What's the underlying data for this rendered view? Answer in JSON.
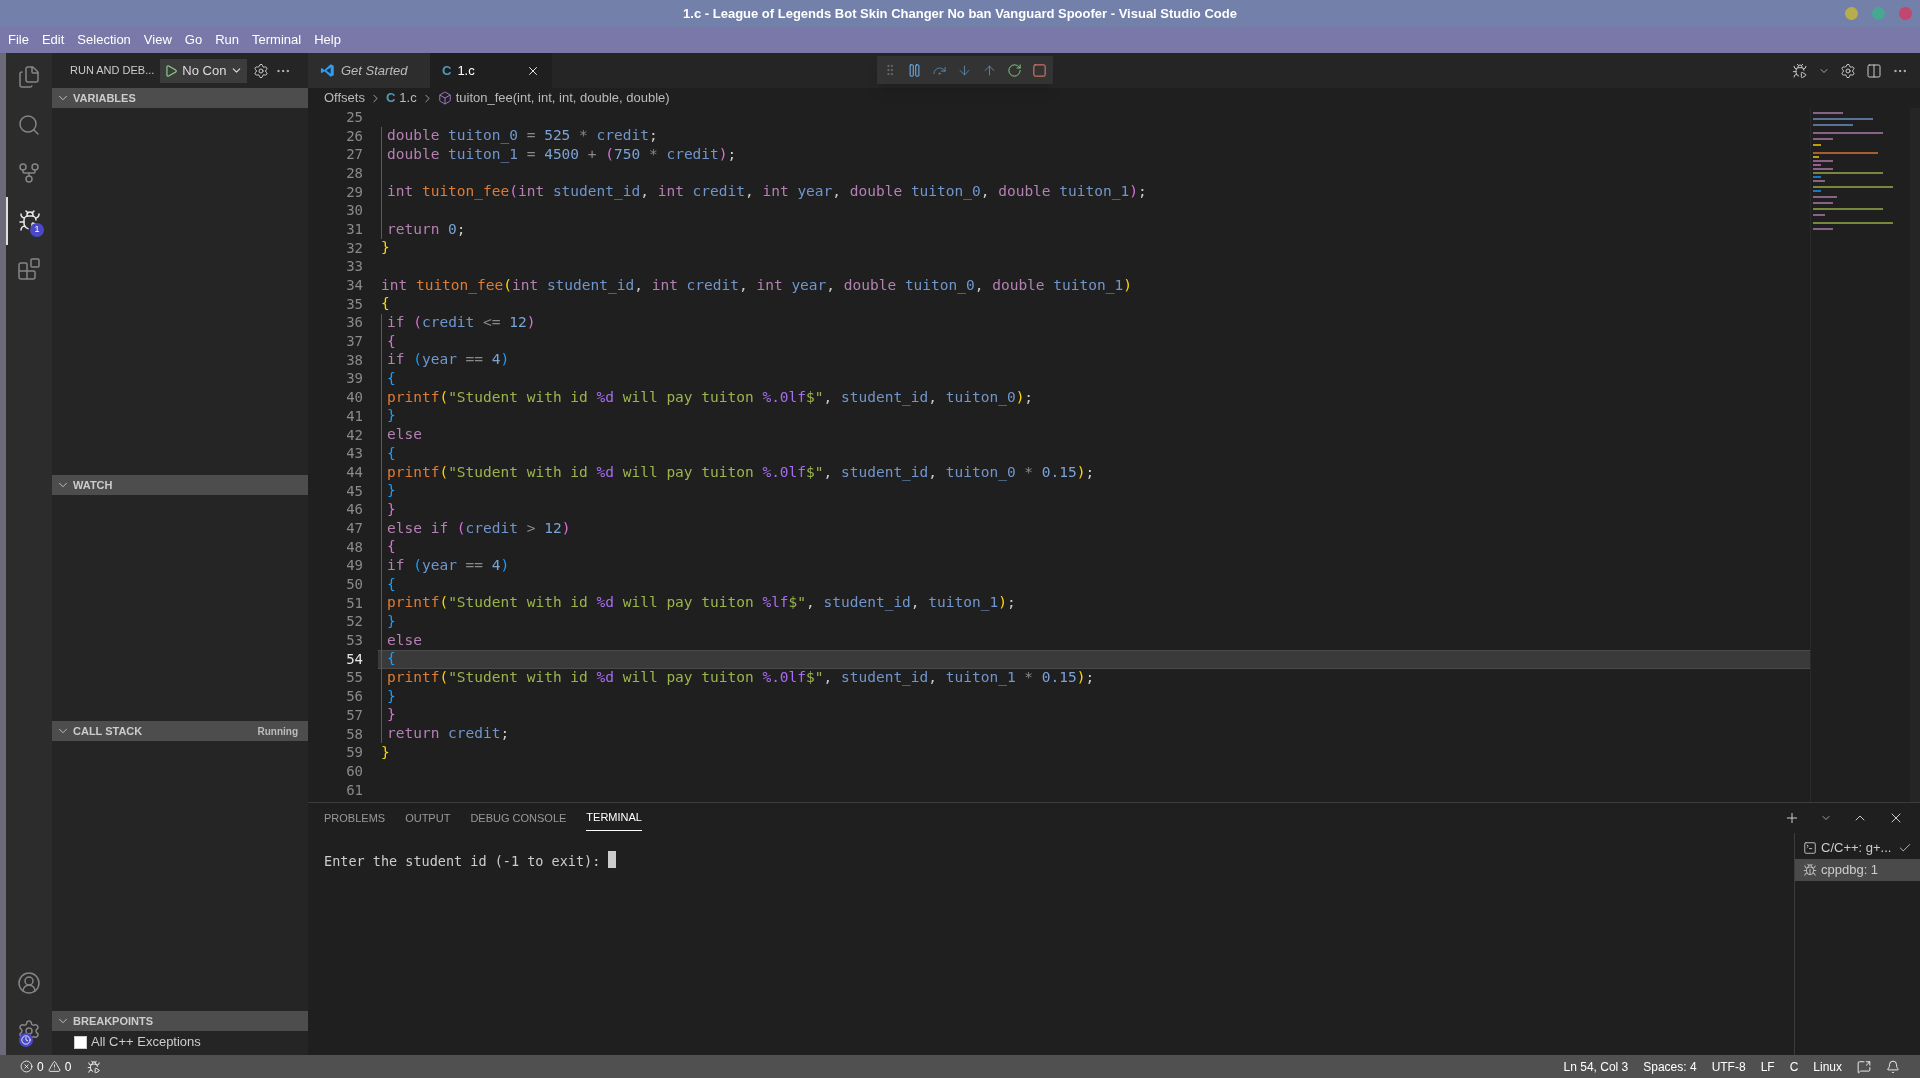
{
  "window": {
    "title": "1.c - League of Legends Bot Skin Changer No ban Vanguard Spoofer - Visual Studio Code"
  },
  "menu": [
    "File",
    "Edit",
    "Selection",
    "View",
    "Go",
    "Run",
    "Terminal",
    "Help"
  ],
  "activity_bar": {
    "items": [
      {
        "kind": "files",
        "selected": false
      },
      {
        "kind": "search",
        "selected": false
      },
      {
        "kind": "source-control",
        "selected": false
      },
      {
        "kind": "run-debug",
        "selected": true,
        "badge": "1"
      },
      {
        "kind": "extensions",
        "selected": false
      }
    ]
  },
  "sidebar": {
    "title": "RUN AND DEB...",
    "launch_config": "No Con",
    "sections": [
      {
        "title": "VARIABLES",
        "expanded": true
      },
      {
        "title": "WATCH",
        "expanded": true
      },
      {
        "title": "CALL STACK",
        "expanded": true,
        "status": "Running"
      },
      {
        "title": "BREAKPOINTS",
        "expanded": true,
        "items": [
          {
            "label": "All C++ Exceptions",
            "checked": false
          }
        ]
      }
    ]
  },
  "tabs": [
    {
      "label": "Get Started",
      "kind": "welcome",
      "selected": false
    },
    {
      "label": "1.c",
      "kind": "c-file",
      "file_type": "C",
      "selected": true
    }
  ],
  "breadcrumb": {
    "folder": "Offsets",
    "file_type": "C",
    "file": "1.c",
    "symbol": "tuiton_fee(int, int, int, double, double)"
  },
  "code_lines": [
    {
      "number": "25",
      "current": false,
      "indented": false
    },
    {
      "number": "26",
      "current": false,
      "indented": true,
      "tokens": [
        {
          "kind": "kw",
          "text": "double "
        },
        {
          "kind": "var",
          "text": "tuiton_0"
        },
        {
          "kind": "op",
          "text": " = "
        },
        {
          "kind": "num",
          "text": "525"
        },
        {
          "kind": "op",
          "text": " * "
        },
        {
          "kind": "var",
          "text": "credit"
        },
        {
          "kind": "plain",
          "text": ";"
        }
      ]
    },
    {
      "number": "27",
      "current": false,
      "indented": true,
      "tokens": [
        {
          "kind": "kw",
          "text": "double "
        },
        {
          "kind": "var",
          "text": "tuiton_1"
        },
        {
          "kind": "op",
          "text": " = "
        },
        {
          "kind": "num",
          "text": "4500"
        },
        {
          "kind": "op",
          "text": " + "
        },
        {
          "kind": "b2",
          "text": "("
        },
        {
          "kind": "num",
          "text": "750"
        },
        {
          "kind": "op",
          "text": " * "
        },
        {
          "kind": "var",
          "text": "credit"
        },
        {
          "kind": "b2",
          "text": ")"
        },
        {
          "kind": "plain",
          "text": ";"
        }
      ]
    },
    {
      "number": "28",
      "current": false,
      "indented": true
    },
    {
      "number": "29",
      "current": false,
      "indented": true,
      "tokens": [
        {
          "kind": "kw",
          "text": "int "
        },
        {
          "kind": "fn",
          "text": "tuiton_fee"
        },
        {
          "kind": "b2",
          "text": "("
        },
        {
          "kind": "kw",
          "text": "int "
        },
        {
          "kind": "var",
          "text": "student_id"
        },
        {
          "kind": "plain",
          "text": ", "
        },
        {
          "kind": "kw",
          "text": "int "
        },
        {
          "kind": "var",
          "text": "credit"
        },
        {
          "kind": "plain",
          "text": ", "
        },
        {
          "kind": "kw",
          "text": "int "
        },
        {
          "kind": "var",
          "text": "year"
        },
        {
          "kind": "plain",
          "text": ", "
        },
        {
          "kind": "kw",
          "text": "double "
        },
        {
          "kind": "var",
          "text": "tuiton_0"
        },
        {
          "kind": "plain",
          "text": ", "
        },
        {
          "kind": "kw",
          "text": "double "
        },
        {
          "kind": "var",
          "text": "tuiton_1"
        },
        {
          "kind": "b2",
          "text": ")"
        },
        {
          "kind": "plain",
          "text": ";"
        }
      ]
    },
    {
      "number": "30",
      "current": false,
      "indented": true
    },
    {
      "number": "31",
      "current": false,
      "indented": true,
      "tokens": [
        {
          "kind": "kw",
          "text": "return "
        },
        {
          "kind": "num",
          "text": "0"
        },
        {
          "kind": "plain",
          "text": ";"
        }
      ]
    },
    {
      "number": "32",
      "current": false,
      "indented": false,
      "tokens": [
        {
          "kind": "b1",
          "text": "}"
        }
      ]
    },
    {
      "number": "33",
      "current": false,
      "indented": false
    },
    {
      "number": "34",
      "current": false,
      "indented": false,
      "tokens": [
        {
          "kind": "kw",
          "text": "int "
        },
        {
          "kind": "fn",
          "text": "tuiton_fee"
        },
        {
          "kind": "b1",
          "text": "("
        },
        {
          "kind": "kw",
          "text": "int "
        },
        {
          "kind": "var",
          "text": "student_id"
        },
        {
          "kind": "plain",
          "text": ", "
        },
        {
          "kind": "kw",
          "text": "int "
        },
        {
          "kind": "var",
          "text": "credit"
        },
        {
          "kind": "plain",
          "text": ", "
        },
        {
          "kind": "kw",
          "text": "int "
        },
        {
          "kind": "var",
          "text": "year"
        },
        {
          "kind": "plain",
          "text": ", "
        },
        {
          "kind": "kw",
          "text": "double "
        },
        {
          "kind": "var",
          "text": "tuiton_0"
        },
        {
          "kind": "plain",
          "text": ", "
        },
        {
          "kind": "kw",
          "text": "double "
        },
        {
          "kind": "var",
          "text": "tuiton_1"
        },
        {
          "kind": "b1",
          "text": ")"
        }
      ]
    },
    {
      "number": "35",
      "current": false,
      "indented": false,
      "tokens": [
        {
          "kind": "b1",
          "text": "{"
        }
      ]
    },
    {
      "number": "36",
      "current": false,
      "indented": true,
      "tokens": [
        {
          "kind": "kw",
          "text": "if "
        },
        {
          "kind": "b2",
          "text": "("
        },
        {
          "kind": "var",
          "text": "credit"
        },
        {
          "kind": "op",
          "text": " <= "
        },
        {
          "kind": "num",
          "text": "12"
        },
        {
          "kind": "b2",
          "text": ")"
        }
      ]
    },
    {
      "number": "37",
      "current": false,
      "indented": true,
      "tokens": [
        {
          "kind": "b2",
          "text": "{"
        }
      ]
    },
    {
      "number": "38",
      "current": false,
      "indented": true,
      "tokens": [
        {
          "kind": "kw",
          "text": "if "
        },
        {
          "kind": "b3",
          "text": "("
        },
        {
          "kind": "var",
          "text": "year"
        },
        {
          "kind": "op",
          "text": " == "
        },
        {
          "kind": "num",
          "text": "4"
        },
        {
          "kind": "b3",
          "text": ")"
        }
      ]
    },
    {
      "number": "39",
      "current": false,
      "indented": true,
      "tokens": [
        {
          "kind": "b3",
          "text": "{"
        }
      ]
    },
    {
      "number": "40",
      "current": false,
      "indented": true,
      "tokens": [
        {
          "kind": "fn",
          "text": "printf"
        },
        {
          "kind": "b1",
          "text": "("
        },
        {
          "kind": "str",
          "text": "\"Student with id "
        },
        {
          "kind": "fmt",
          "text": "%d"
        },
        {
          "kind": "str",
          "text": " will pay tuiton "
        },
        {
          "kind": "fmt",
          "text": "%.0lf"
        },
        {
          "kind": "str",
          "text": "$\""
        },
        {
          "kind": "plain",
          "text": ", "
        },
        {
          "kind": "var",
          "text": "student_id"
        },
        {
          "kind": "plain",
          "text": ", "
        },
        {
          "kind": "var",
          "text": "tuiton_0"
        },
        {
          "kind": "b1",
          "text": ")"
        },
        {
          "kind": "plain",
          "text": ";"
        }
      ]
    },
    {
      "number": "41",
      "current": false,
      "indented": true,
      "tokens": [
        {
          "kind": "b3",
          "text": "}"
        }
      ]
    },
    {
      "number": "42",
      "current": false,
      "indented": true,
      "tokens": [
        {
          "kind": "kw",
          "text": "else"
        }
      ]
    },
    {
      "number": "43",
      "current": false,
      "indented": true,
      "tokens": [
        {
          "kind": "b3",
          "text": "{"
        }
      ]
    },
    {
      "number": "44",
      "current": false,
      "indented": true,
      "tokens": [
        {
          "kind": "fn",
          "text": "printf"
        },
        {
          "kind": "b1",
          "text": "("
        },
        {
          "kind": "str",
          "text": "\"Student with id "
        },
        {
          "kind": "fmt",
          "text": "%d"
        },
        {
          "kind": "str",
          "text": " will pay tuiton "
        },
        {
          "kind": "fmt",
          "text": "%.0lf"
        },
        {
          "kind": "str",
          "text": "$\""
        },
        {
          "kind": "plain",
          "text": ", "
        },
        {
          "kind": "var",
          "text": "student_id"
        },
        {
          "kind": "plain",
          "text": ", "
        },
        {
          "kind": "var",
          "text": "tuiton_0"
        },
        {
          "kind": "op",
          "text": " * "
        },
        {
          "kind": "num",
          "text": "0.15"
        },
        {
          "kind": "b1",
          "text": ")"
        },
        {
          "kind": "plain",
          "text": ";"
        }
      ]
    },
    {
      "number": "45",
      "current": false,
      "indented": true,
      "tokens": [
        {
          "kind": "b3",
          "text": "}"
        }
      ]
    },
    {
      "number": "46",
      "current": false,
      "indented": true,
      "tokens": [
        {
          "kind": "b2",
          "text": "}"
        }
      ]
    },
    {
      "number": "47",
      "current": false,
      "indented": true,
      "tokens": [
        {
          "kind": "kw",
          "text": "else if "
        },
        {
          "kind": "b2",
          "text": "("
        },
        {
          "kind": "var",
          "text": "credit"
        },
        {
          "kind": "op",
          "text": " > "
        },
        {
          "kind": "num",
          "text": "12"
        },
        {
          "kind": "b2",
          "text": ")"
        }
      ]
    },
    {
      "number": "48",
      "current": false,
      "indented": true,
      "tokens": [
        {
          "kind": "b2",
          "text": "{"
        }
      ]
    },
    {
      "number": "49",
      "current": false,
      "indented": true,
      "tokens": [
        {
          "kind": "kw",
          "text": "if "
        },
        {
          "kind": "b3",
          "text": "("
        },
        {
          "kind": "var",
          "text": "year"
        },
        {
          "kind": "op",
          "text": " == "
        },
        {
          "kind": "num",
          "text": "4"
        },
        {
          "kind": "b3",
          "text": ")"
        }
      ]
    },
    {
      "number": "50",
      "current": false,
      "indented": true,
      "tokens": [
        {
          "kind": "b3",
          "text": "{"
        }
      ]
    },
    {
      "number": "51",
      "current": false,
      "indented": true,
      "tokens": [
        {
          "kind": "fn",
          "text": "printf"
        },
        {
          "kind": "b1",
          "text": "("
        },
        {
          "kind": "str",
          "text": "\"Student with id "
        },
        {
          "kind": "fmt",
          "text": "%d"
        },
        {
          "kind": "str",
          "text": " will pay tuiton "
        },
        {
          "kind": "fmt",
          "text": "%lf"
        },
        {
          "kind": "str",
          "text": "$\""
        },
        {
          "kind": "plain",
          "text": ", "
        },
        {
          "kind": "var",
          "text": "student_id"
        },
        {
          "kind": "plain",
          "text": ", "
        },
        {
          "kind": "var",
          "text": "tuiton_1"
        },
        {
          "kind": "b1",
          "text": ")"
        },
        {
          "kind": "plain",
          "text": ";"
        }
      ]
    },
    {
      "number": "52",
      "current": false,
      "indented": true,
      "tokens": [
        {
          "kind": "b3",
          "text": "}"
        }
      ]
    },
    {
      "number": "53",
      "current": false,
      "indented": true,
      "tokens": [
        {
          "kind": "kw",
          "text": "else"
        }
      ]
    },
    {
      "number": "54",
      "current": true,
      "indented": true,
      "tokens": [
        {
          "kind": "b3",
          "text": "{"
        }
      ]
    },
    {
      "number": "55",
      "current": false,
      "indented": true,
      "tokens": [
        {
          "kind": "fn",
          "text": "printf"
        },
        {
          "kind": "b1",
          "text": "("
        },
        {
          "kind": "str",
          "text": "\"Student with id "
        },
        {
          "kind": "fmt",
          "text": "%d"
        },
        {
          "kind": "str",
          "text": " will pay tuiton "
        },
        {
          "kind": "fmt",
          "text": "%.0lf"
        },
        {
          "kind": "str",
          "text": "$\""
        },
        {
          "kind": "plain",
          "text": ", "
        },
        {
          "kind": "var",
          "text": "student_id"
        },
        {
          "kind": "plain",
          "text": ", "
        },
        {
          "kind": "var",
          "text": "tuiton_1"
        },
        {
          "kind": "op",
          "text": " * "
        },
        {
          "kind": "num",
          "text": "0.15"
        },
        {
          "kind": "b1",
          "text": ")"
        },
        {
          "kind": "plain",
          "text": ";"
        }
      ]
    },
    {
      "number": "56",
      "current": false,
      "indented": true,
      "tokens": [
        {
          "kind": "b3",
          "text": "}"
        }
      ]
    },
    {
      "number": "57",
      "current": false,
      "indented": true,
      "tokens": [
        {
          "kind": "b2",
          "text": "}"
        }
      ]
    },
    {
      "number": "58",
      "current": false,
      "indented": true,
      "tokens": [
        {
          "kind": "kw",
          "text": "return "
        },
        {
          "kind": "var",
          "text": "credit"
        },
        {
          "kind": "plain",
          "text": ";"
        }
      ]
    },
    {
      "number": "59",
      "current": false,
      "indented": false,
      "tokens": [
        {
          "kind": "b1",
          "text": "}"
        }
      ]
    },
    {
      "number": "60",
      "current": false,
      "indented": false
    },
    {
      "number": "61",
      "current": false,
      "indented": false
    }
  ],
  "panel": {
    "tabs": [
      {
        "label": "PROBLEMS",
        "selected": false
      },
      {
        "label": "OUTPUT",
        "selected": false
      },
      {
        "label": "DEBUG CONSOLE",
        "selected": false
      },
      {
        "label": "TERMINAL",
        "selected": true
      }
    ],
    "terminal_text": "Enter the student id (-1 to exit):",
    "terminals": [
      {
        "label": "C/C++: g+...",
        "kind": "task",
        "selected": false
      },
      {
        "label": "cppdbg: 1",
        "kind": "debug",
        "selected": true
      }
    ]
  },
  "status_bar": {
    "errors": "0",
    "warnings": "0",
    "items": [
      "Ln 54, Col 3",
      "Spaces: 4",
      "UTF-8",
      "LF",
      "C",
      "Linux"
    ]
  }
}
